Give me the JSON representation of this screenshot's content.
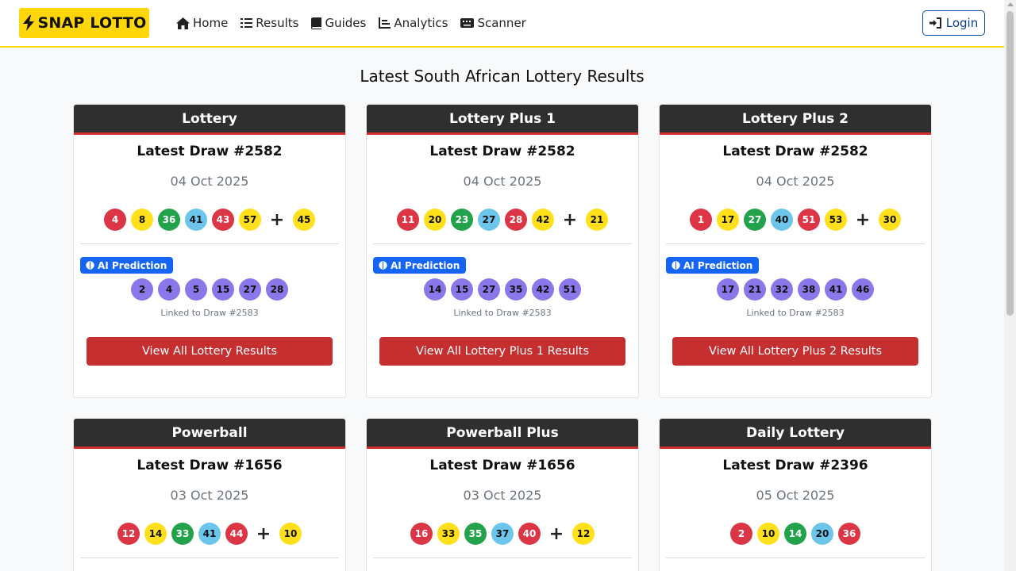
{
  "brand": {
    "name": "SNAP LOTTO"
  },
  "nav": [
    {
      "label": "Home",
      "icon": "home-icon"
    },
    {
      "label": "Results",
      "icon": "list-icon"
    },
    {
      "label": "Guides",
      "icon": "book-icon"
    },
    {
      "label": "Analytics",
      "icon": "chart-icon"
    },
    {
      "label": "Scanner",
      "icon": "keyboard-icon"
    }
  ],
  "login_label": "Login",
  "page_title": "Latest South African Lottery Results",
  "cards": [
    {
      "name": "Lottery",
      "draw": "Latest Draw #2582",
      "date": "04 Oct 2025",
      "numbers": [
        {
          "n": "4",
          "c": "red"
        },
        {
          "n": "8",
          "c": "yellow"
        },
        {
          "n": "36",
          "c": "green"
        },
        {
          "n": "41",
          "c": "blue"
        },
        {
          "n": "43",
          "c": "red"
        },
        {
          "n": "57",
          "c": "yellow"
        }
      ],
      "bonus": {
        "n": "45",
        "c": "yellow"
      },
      "ai_label": "AI Prediction",
      "prediction": [
        "2",
        "4",
        "5",
        "15",
        "27",
        "28"
      ],
      "linked": "Linked to Draw #2583",
      "button": "View All Lottery Results"
    },
    {
      "name": "Lottery Plus 1",
      "draw": "Latest Draw #2582",
      "date": "04 Oct 2025",
      "numbers": [
        {
          "n": "11",
          "c": "red"
        },
        {
          "n": "20",
          "c": "yellow"
        },
        {
          "n": "23",
          "c": "green"
        },
        {
          "n": "27",
          "c": "blue"
        },
        {
          "n": "28",
          "c": "red"
        },
        {
          "n": "42",
          "c": "yellow"
        }
      ],
      "bonus": {
        "n": "21",
        "c": "yellow"
      },
      "ai_label": "AI Prediction",
      "prediction": [
        "14",
        "15",
        "27",
        "35",
        "42",
        "51"
      ],
      "linked": "Linked to Draw #2583",
      "button": "View All Lottery Plus 1 Results"
    },
    {
      "name": "Lottery Plus 2",
      "draw": "Latest Draw #2582",
      "date": "04 Oct 2025",
      "numbers": [
        {
          "n": "1",
          "c": "red"
        },
        {
          "n": "17",
          "c": "yellow"
        },
        {
          "n": "27",
          "c": "green"
        },
        {
          "n": "40",
          "c": "blue"
        },
        {
          "n": "51",
          "c": "red"
        },
        {
          "n": "53",
          "c": "yellow"
        }
      ],
      "bonus": {
        "n": "30",
        "c": "yellow"
      },
      "ai_label": "AI Prediction",
      "prediction": [
        "17",
        "21",
        "32",
        "38",
        "41",
        "46"
      ],
      "linked": "Linked to Draw #2583",
      "button": "View All Lottery Plus 2 Results"
    },
    {
      "name": "Powerball",
      "draw": "Latest Draw #1656",
      "date": "03 Oct 2025",
      "numbers": [
        {
          "n": "12",
          "c": "red"
        },
        {
          "n": "14",
          "c": "yellow"
        },
        {
          "n": "33",
          "c": "green"
        },
        {
          "n": "41",
          "c": "blue"
        },
        {
          "n": "44",
          "c": "red"
        }
      ],
      "bonus": {
        "n": "10",
        "c": "yellow"
      }
    },
    {
      "name": "Powerball Plus",
      "draw": "Latest Draw #1656",
      "date": "03 Oct 2025",
      "numbers": [
        {
          "n": "16",
          "c": "red"
        },
        {
          "n": "33",
          "c": "yellow"
        },
        {
          "n": "35",
          "c": "green"
        },
        {
          "n": "37",
          "c": "blue"
        },
        {
          "n": "40",
          "c": "red"
        }
      ],
      "bonus": {
        "n": "12",
        "c": "yellow"
      }
    },
    {
      "name": "Daily Lottery",
      "draw": "Latest Draw #2396",
      "date": "05 Oct 2025",
      "numbers": [
        {
          "n": "2",
          "c": "red"
        },
        {
          "n": "10",
          "c": "yellow"
        },
        {
          "n": "14",
          "c": "green"
        },
        {
          "n": "20",
          "c": "blue"
        },
        {
          "n": "36",
          "c": "red"
        }
      ],
      "bonus": null
    }
  ],
  "colors": {
    "accent": "#ffd60a",
    "header": "#2f2f2f",
    "button": "#c62f30",
    "ai_badge": "#1565f5"
  }
}
